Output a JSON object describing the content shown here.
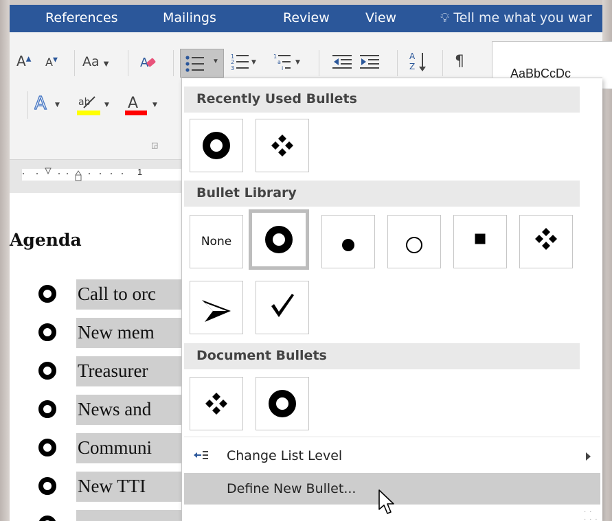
{
  "ribbon_tabs": [
    "References",
    "Mailings",
    "Review",
    "View"
  ],
  "tell_me": "Tell me what you war",
  "styles_sample": "AaBbCcDc",
  "ruler_number": "1",
  "document": {
    "heading": "Agenda",
    "items": [
      "Call to orc",
      "New mem",
      "Treasurer",
      "News and",
      "Communi",
      "New TTI",
      ""
    ]
  },
  "dropdown": {
    "recently_used_header": "Recently Used Bullets",
    "bullet_library_header": "Bullet Library",
    "document_bullets_header": "Document Bullets",
    "none_label": "None",
    "change_list_level": "Change List Level",
    "define_new_bullet": "Define New Bullet..."
  },
  "icons": {
    "recently_used": [
      "hollow-circle-bullet",
      "diamond-cluster-bullet"
    ],
    "library": [
      "none",
      "hollow-circle-bullet",
      "solid-dot-bullet",
      "ring-bullet",
      "square-bullet",
      "diamond-cluster-bullet",
      "arrowhead-bullet",
      "checkmark-bullet"
    ],
    "document": [
      "diamond-cluster-bullet",
      "hollow-circle-bullet"
    ]
  },
  "colors": {
    "ribbon_tab_bar": "#2b579a",
    "highlight_yellow": "#ffff00",
    "font_color_red": "#ff0000",
    "text_effect_blue": "#4a79c4",
    "hover_gray": "#cdcdcd"
  }
}
